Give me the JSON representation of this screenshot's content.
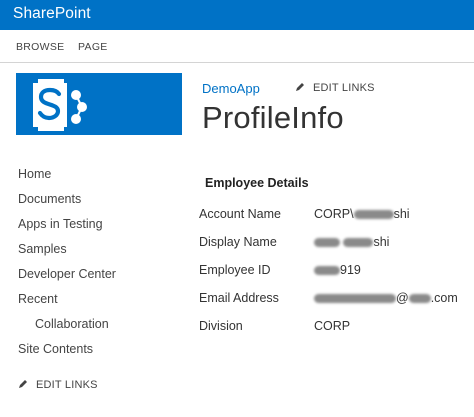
{
  "suite_bar": {
    "title": "SharePoint"
  },
  "ribbon": {
    "tabs": [
      "BROWSE",
      "PAGE"
    ]
  },
  "header": {
    "site_link": "DemoApp",
    "edit_links": "EDIT LINKS",
    "page_title": "ProfileInfo"
  },
  "quick_launch": {
    "items": [
      "Home",
      "Documents",
      "Apps in Testing",
      "Samples",
      "Developer Center",
      "Recent",
      "Collaboration",
      "Site Contents"
    ],
    "edit_links": "EDIT LINKS"
  },
  "details": {
    "heading": "Employee Details",
    "rows": [
      {
        "label": "Account Name",
        "value_visible": "CORP\\",
        "value_suffix": "shi"
      },
      {
        "label": "Display Name",
        "value_visible": "",
        "value_suffix": "shi"
      },
      {
        "label": "Employee ID",
        "value_visible": "",
        "value_suffix": "919"
      },
      {
        "label": "Email Address",
        "value_visible": "",
        "value_suffix": "@",
        "value_tail": ".com"
      },
      {
        "label": "Division",
        "value_visible": "CORP",
        "value_suffix": ""
      }
    ]
  },
  "colors": {
    "brand": "#0072c6",
    "text": "#444444"
  },
  "icons": {
    "logo": "sharepoint-logo",
    "edit": "pencil-icon"
  }
}
